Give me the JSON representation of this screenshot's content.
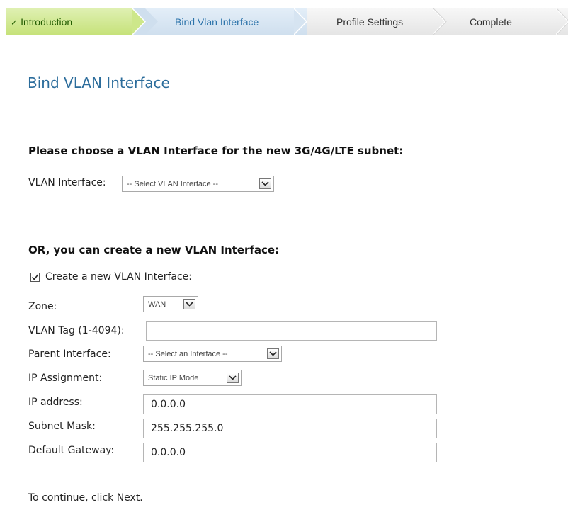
{
  "wizard": {
    "steps": [
      {
        "label": "Introduction",
        "state": "done"
      },
      {
        "label": "Bind Vlan Interface",
        "state": "current"
      },
      {
        "label": "Profile Settings",
        "state": "pending"
      },
      {
        "label": "Complete",
        "state": "pending"
      }
    ],
    "check_glyph": "✓"
  },
  "page": {
    "title": "Bind VLAN Interface",
    "choose_heading": "Please choose a VLAN Interface for the new 3G/4G/LTE subnet:",
    "vlan_interface_label": "VLAN Interface:",
    "vlan_interface_value": "-- Select VLAN Interface --",
    "or_heading": "OR, you can create a new VLAN Interface:",
    "create_checkbox_label": "Create a new VLAN Interface:",
    "create_checked": true,
    "zone_label": "Zone:",
    "zone_value": "WAN",
    "vlan_tag_label": "VLAN Tag (1-4094):",
    "vlan_tag_value": "",
    "parent_label": "Parent Interface:",
    "parent_value": "-- Select an Interface --",
    "ip_assignment_label": "IP Assignment:",
    "ip_assignment_value": "Static IP Mode",
    "ip_address_label": "IP address:",
    "ip_address_value": "0.0.0.0",
    "subnet_label": "Subnet Mask:",
    "subnet_value": "255.255.255.0",
    "gateway_label": "Default Gateway:",
    "gateway_value": "0.0.0.0",
    "footer_text": "To continue, click Next."
  },
  "colors": {
    "title": "#2b6c9b",
    "step_done": "#c6e27a",
    "step_current": "#cfdfee"
  }
}
